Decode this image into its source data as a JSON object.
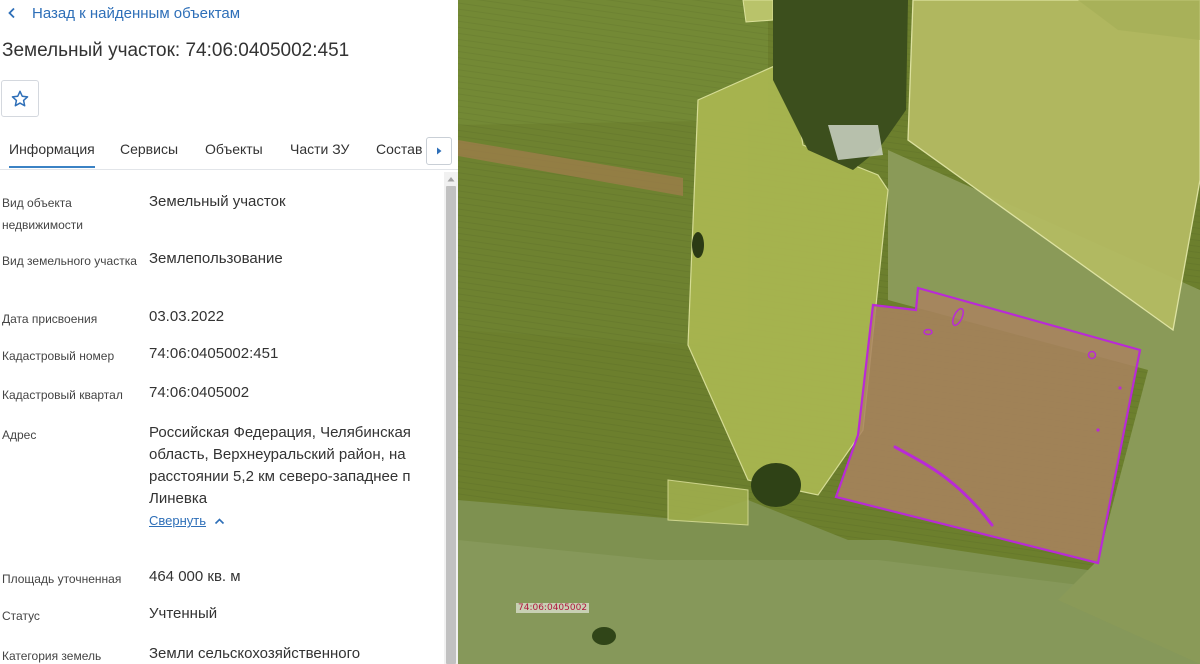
{
  "header": {
    "back_label": "Назад к найденным объектам",
    "title": "Земельный участок: 74:06:0405002:451"
  },
  "tabs": [
    {
      "label": "Информация",
      "active": true
    },
    {
      "label": "Сервисы",
      "active": false
    },
    {
      "label": "Объекты",
      "active": false
    },
    {
      "label": "Части ЗУ",
      "active": false
    },
    {
      "label": "Состав",
      "active": false
    }
  ],
  "info": {
    "property_type": {
      "label": "Вид объекта недвижимости",
      "value": "Земельный участок"
    },
    "land_type": {
      "label": "Вид земельного участка",
      "value": "Землепользование"
    },
    "assign_date": {
      "label": "Дата присвоения",
      "value": "03.03.2022"
    },
    "cadastral_number": {
      "label": "Кадастровый номер",
      "value": "74:06:0405002:451"
    },
    "cadastral_quarter": {
      "label": "Кадастровый квартал",
      "value": "74:06:0405002"
    },
    "address": {
      "label": "Адрес",
      "value": "Российская Федерация, Челябинская область, Верхнеуральский район, на расстоянии 5,2 км северо-западнее п Линевка",
      "collapse_label": "Свернуть"
    },
    "area": {
      "label": "Площадь уточненная",
      "value": "464 000 кв. м"
    },
    "status": {
      "label": "Статус",
      "value": "Учтенный"
    },
    "category": {
      "label": "Категория земель",
      "value": "Земли сельскохозяйственного"
    }
  },
  "map": {
    "quarter_label": "74:06:0405002",
    "parcel_outline_color": "#b92ad6",
    "accent_color": "#3b82c4"
  },
  "icons": {
    "back": "chevron-left-icon",
    "favorite": "star-outline-icon",
    "tabs_next": "triangle-right-icon",
    "collapse": "chevron-up-icon"
  }
}
